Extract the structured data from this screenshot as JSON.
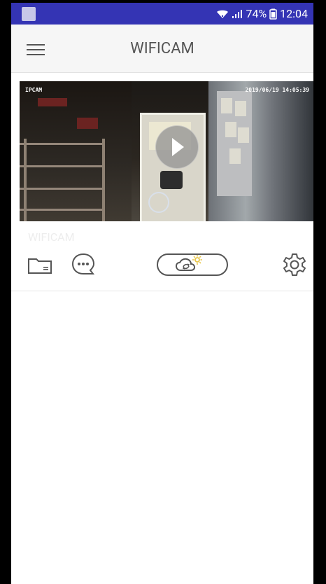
{
  "status_bar": {
    "battery": "74%",
    "time": "12:04"
  },
  "app_bar": {
    "title": "WIFICAM"
  },
  "video": {
    "overlay_left": "IPCAM",
    "overlay_right": "2019/06/19 14:05:39"
  },
  "camera": {
    "name": "WIFICAM"
  },
  "icons": {
    "menu": "menu-icon",
    "play": "play-icon",
    "folder": "folder-icon",
    "chat": "chat-icon",
    "cloud": "cloud-weather-icon",
    "settings": "settings-icon",
    "wifi": "wifi-icon",
    "signal": "signal-icon",
    "battery": "battery-icon"
  },
  "colors": {
    "status_bar": "#3434b4",
    "appbar": "#f6f6f6",
    "text": "#555555",
    "accent_sun": "#e8c64a"
  }
}
